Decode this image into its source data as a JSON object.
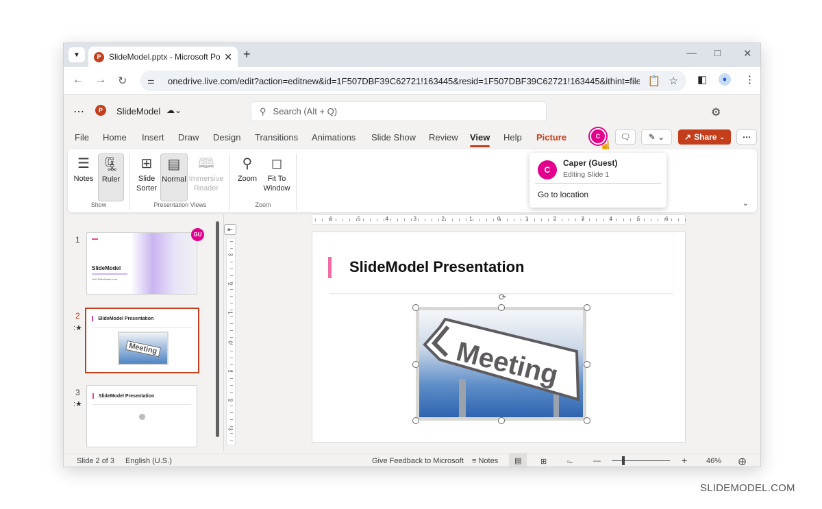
{
  "browser": {
    "tab_title": "SlideModel.pptx - Microsoft Po",
    "url": "onedrive.live.com/edit?action=editnew&id=1F507DBF39C62721!163445&resid=1F507DBF39C62721!163445&ithint=file..."
  },
  "app": {
    "logo_letter": "P",
    "doc_name": "SlideModel",
    "search_placeholder": "Search (Alt + Q)"
  },
  "menu": {
    "tabs": [
      "File",
      "Home",
      "Insert",
      "Draw",
      "Design",
      "Transitions",
      "Animations",
      "Slide Show",
      "Review",
      "View",
      "Help",
      "Picture"
    ],
    "active": "View",
    "contextual": "Picture",
    "share_label": "Share",
    "collaborator_initial": "C"
  },
  "ribbon": {
    "groups": [
      {
        "label": "Show",
        "buttons": [
          {
            "label": "Notes",
            "icon": "notes-icon"
          },
          {
            "label": "Ruler",
            "icon": "ruler-icon",
            "selected": true
          }
        ]
      },
      {
        "label": "Presentation Views",
        "buttons": [
          {
            "label": "Slide Sorter",
            "icon": "slide-sorter-icon"
          },
          {
            "label": "Normal",
            "icon": "normal-view-icon",
            "selected": true
          },
          {
            "label": "Immersive Reader",
            "icon": "immersive-reader-icon",
            "disabled": true
          }
        ]
      },
      {
        "label": "Zoom",
        "buttons": [
          {
            "label": "Zoom",
            "icon": "zoom-icon"
          },
          {
            "label": "Fit To Window",
            "icon": "fit-window-icon"
          }
        ]
      }
    ]
  },
  "popup": {
    "initial": "C",
    "name": "Caper (Guest)",
    "status": "Editing Slide 1",
    "action": "Go to location"
  },
  "thumbnails": [
    {
      "number": "1",
      "title": "SlideModel",
      "subtitle": "Visit SlideModel.com",
      "badge": "GU"
    },
    {
      "number": "2",
      "title": "SlideModel Presentation",
      "image_text": "Meeting",
      "current": true,
      "has_animation": true
    },
    {
      "number": "3",
      "title": "SlideModel Presentation",
      "has_animation": true
    }
  ],
  "ruler": {
    "horizontal": [
      "6",
      "5",
      "4",
      "3",
      "2",
      "1",
      "0",
      "1",
      "2",
      "3",
      "4",
      "5",
      "6"
    ],
    "vertical": [
      "3",
      "2",
      "1",
      "0",
      "1",
      "2",
      "3"
    ]
  },
  "slide": {
    "title": "SlideModel Presentation",
    "image_text": "Meeting"
  },
  "status": {
    "slide_info": "Slide 2 of 3",
    "language": "English (U.S.)",
    "feedback": "Give Feedback to Microsoft",
    "notes": "Notes",
    "zoom": "46%",
    "zoom_fraction": 0.46
  },
  "watermark": "SLIDEMODEL.COM"
}
